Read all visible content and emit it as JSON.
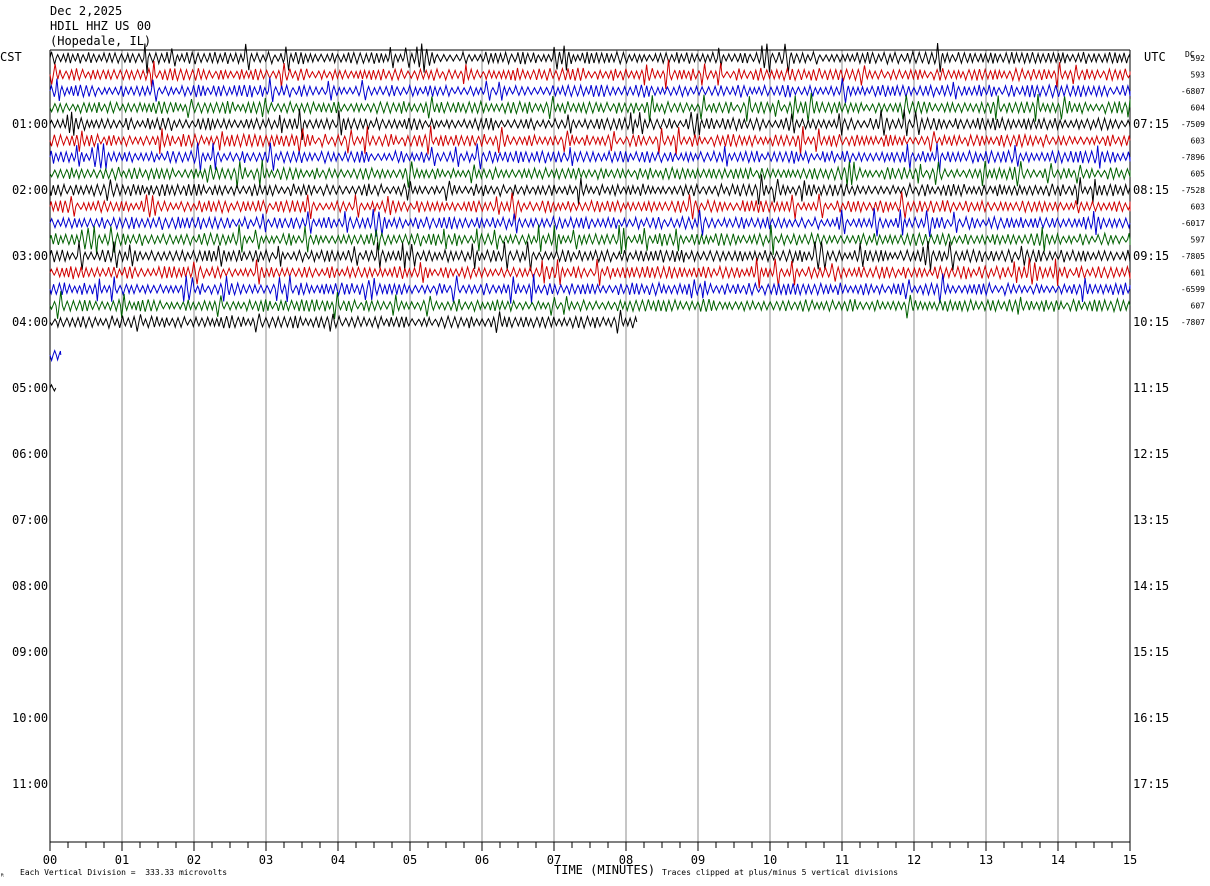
{
  "header": {
    "date": "Dec 2,2025",
    "station": "HDIL HHZ US 00",
    "location": "(Hopedale, IL)"
  },
  "axis_labels": {
    "left_timezone": "CST",
    "right_timezone": "UTC",
    "dc_header": "DC",
    "x_title": "TIME (MINUTES)"
  },
  "footer": {
    "scale_note": "Each Vertical Division =  333.33 microvolts",
    "clip_note": "Traces clipped at plus/minus 5 vertical divisions",
    "corner_mark": "ᴿ"
  },
  "chart_data": {
    "type": "line",
    "title": "",
    "xlabel": "TIME (MINUTES)",
    "xlim": [
      0,
      15
    ],
    "x_tick_labels": [
      "00",
      "01",
      "02",
      "03",
      "04",
      "05",
      "06",
      "07",
      "08",
      "09",
      "10",
      "11",
      "12",
      "13",
      "14",
      "15"
    ],
    "minor_ticks_per_minute": 4,
    "trace_colors": [
      "#000000",
      "#d00000",
      "#0000d0",
      "#006000"
    ],
    "rows_per_hour": 4,
    "cst_hour_labels": [
      "01:00",
      "02:00",
      "03:00",
      "04:00",
      "05:00",
      "06:00",
      "07:00",
      "08:00",
      "09:00",
      "10:00",
      "11:00"
    ],
    "utc_hour_labels": [
      "07:15",
      "08:15",
      "09:15",
      "10:15",
      "11:15",
      "12:15",
      "13:15",
      "14:15",
      "15:15",
      "16:15",
      "17:15"
    ],
    "dc_offsets": [
      "592",
      "593",
      "-6807",
      "604",
      "-7509",
      "603",
      "-7896",
      "605",
      "-7528",
      "603",
      "-6017",
      "597",
      "-7805",
      "601",
      "-6599",
      "607",
      "-7807"
    ],
    "full_rows": 16,
    "partial_row_end_minute": 8.15,
    "extra_trace_fragments": [
      {
        "row": 18,
        "start_minute": 0.0,
        "end_minute": 0.15,
        "color": "#0000d0"
      },
      {
        "row": 20,
        "start_minute": 0.0,
        "end_minute": 0.08,
        "color": "#000000"
      }
    ]
  }
}
